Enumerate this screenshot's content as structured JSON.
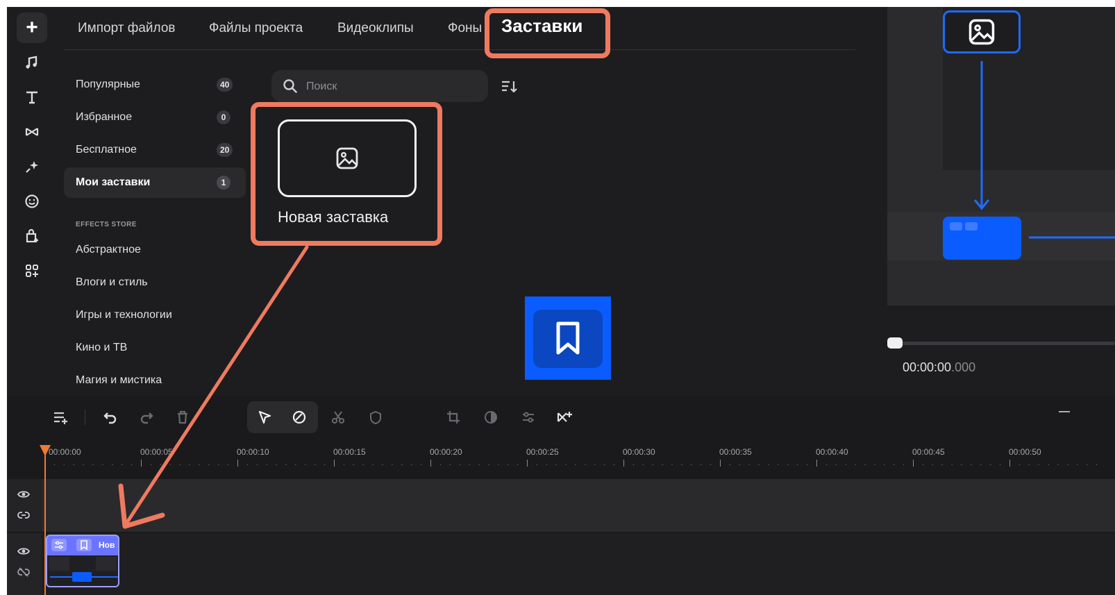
{
  "tabs": {
    "import": "Импорт файлов",
    "project_files": "Файлы проекта",
    "clips": "Видеоклипы",
    "backgrounds": "Фоны",
    "intros": "Заставки"
  },
  "categories": [
    {
      "label": "Популярные",
      "count": "40"
    },
    {
      "label": "Избранное",
      "count": "0"
    },
    {
      "label": "Бесплатное",
      "count": "20"
    },
    {
      "label": "Мои заставки",
      "count": "1"
    }
  ],
  "effects_store": {
    "heading": "EFFECTS STORE",
    "items": [
      "Абстрактное",
      "Влоги и стиль",
      "Игры и технологии",
      "Кино и ТВ",
      "Магия и мистика"
    ]
  },
  "search": {
    "placeholder": "Поиск"
  },
  "card": {
    "label": "Новая заставка"
  },
  "preview": {
    "time_main": "00:00:00",
    "time_ms": ".000"
  },
  "ruler": [
    "00:00:00",
    "00:00:05",
    "00:00:10",
    "00:00:15",
    "00:00:20",
    "00:00:25",
    "00:00:30",
    "00:00:35",
    "00:00:40",
    "00:00:45",
    "00:00:50"
  ],
  "clip": {
    "title": "Нов"
  },
  "colors": {
    "accent_orange": "#ef7a5f",
    "brand_blue": "#0a5cff",
    "clip_purple": "#6b74ff"
  }
}
